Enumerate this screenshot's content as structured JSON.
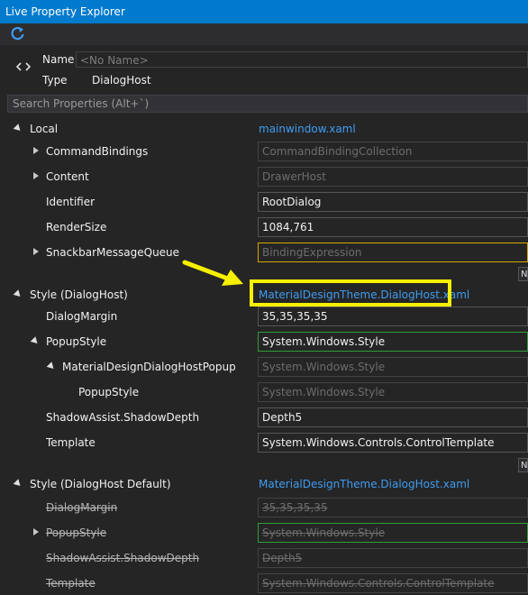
{
  "window": {
    "title": "Live Property Explorer"
  },
  "toolbar": {
    "refresh_icon": "refresh-icon"
  },
  "header": {
    "name_label": "Name",
    "name_placeholder": "<No Name>",
    "type_label": "Type",
    "type_value": "DialogHost"
  },
  "search": {
    "placeholder": "Search Properties (Alt+`)"
  },
  "sections": {
    "local": {
      "label": "Local",
      "source": "mainwindow.xaml",
      "rows": [
        {
          "name": "CommandBindings",
          "value": "CommandBindingCollection"
        },
        {
          "name": "Content",
          "value": "DrawerHost"
        },
        {
          "name": "Identifier",
          "value": "RootDialog"
        },
        {
          "name": "RenderSize",
          "value": "1084,761"
        },
        {
          "name": "SnackbarMessageQueue",
          "value": "BindingExpression"
        }
      ],
      "new_btn": "N"
    },
    "style": {
      "label": "Style (DialogHost)",
      "source": "MaterialDesignTheme.DialogHost.xaml",
      "rows": [
        {
          "name": "DialogMargin",
          "value": "35,35,35,35"
        },
        {
          "name": "PopupStyle",
          "value": "System.Windows.Style"
        },
        {
          "name": "MaterialDesignDialogHostPopup",
          "value": "System.Windows.Style"
        },
        {
          "name": "PopupStyle",
          "value": "System.Windows.Style"
        },
        {
          "name": "ShadowAssist.ShadowDepth",
          "value": "Depth5"
        },
        {
          "name": "Template",
          "value": "System.Windows.Controls.ControlTemplate"
        }
      ],
      "new_btn": "N"
    },
    "style_default": {
      "label": "Style (DialogHost Default)",
      "source": "MaterialDesignTheme.DialogHost.xaml",
      "rows": [
        {
          "name": "DialogMargin",
          "value": "35,35,35,35"
        },
        {
          "name": "PopupStyle",
          "value": "System.Windows.Style"
        },
        {
          "name": "ShadowAssist.ShadowDepth",
          "value": "Depth5"
        },
        {
          "name": "Template",
          "value": "System.Windows.Controls.ControlTemplate"
        }
      ]
    }
  },
  "annotation": {
    "arrow_color": "#f7f000",
    "highlight_color": "#f7f000"
  },
  "colors": {
    "accent": "#007acc",
    "link": "#3e9cf0",
    "background": "#252526"
  }
}
